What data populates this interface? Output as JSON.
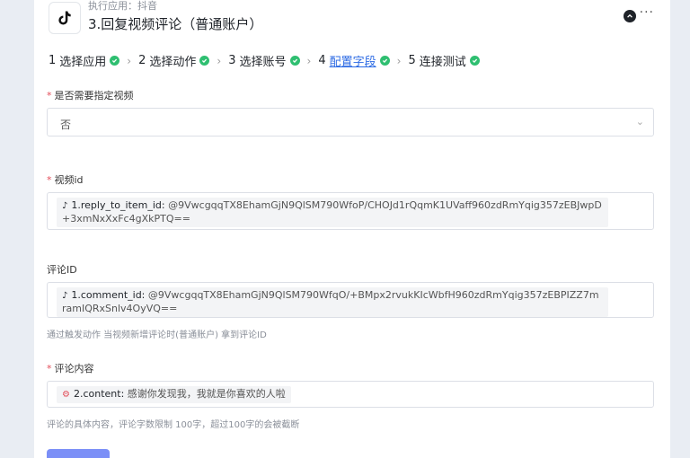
{
  "header": {
    "exec_app": "执行应用：抖音",
    "title": "3.回复视频评论（普通账户）",
    "more": "···",
    "logo_icon": "tiktok-logo-icon"
  },
  "steps": [
    {
      "num": "1",
      "label": "选择应用"
    },
    {
      "num": "2",
      "label": "选择动作"
    },
    {
      "num": "3",
      "label": "选择账号"
    },
    {
      "num": "4",
      "label": "配置字段"
    },
    {
      "num": "5",
      "label": "连接测试"
    }
  ],
  "fields": {
    "specify_video": {
      "label": "是否需要指定视频",
      "value": "否"
    },
    "video_id": {
      "label": "视频id",
      "key": "1.reply_to_item_id:",
      "value": "@9VwcgqqTX8EhamGjN9QlSM790WfoP/CHOJd1rQqmK1UVaff960zdRmYqig357zEBJwpD+3xmNxXxFc4gXkPTQ=="
    },
    "comment_id": {
      "label": "评论ID",
      "key": "1.comment_id:",
      "value": "@9VwcgqqTX8EhamGjN9QlSM790WfqO/+BMpx2rvukKIcWbfH960zdRmYqig357zEBPIZZ7mramIQRxSnlv4OyVQ==",
      "hint": "通过触发动作 当视频新增评论时(普通账户) 拿到评论ID"
    },
    "content": {
      "label": "评论内容",
      "key": "2.content:",
      "value": "感谢你发现我，我就是你喜欢的人啦",
      "hint": "评论的具体内容，评论字数限制 100字，超过100字的会被截断"
    }
  },
  "colors": {
    "accent": "#2d6be4",
    "check": "#2fbf71",
    "required": "#e34d59",
    "button": "#7b8ff7"
  }
}
